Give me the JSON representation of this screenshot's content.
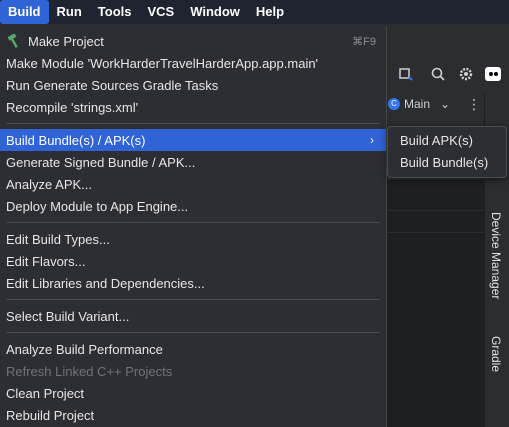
{
  "menubar": {
    "items": [
      "Build",
      "Run",
      "Tools",
      "VCS",
      "Window",
      "Help"
    ],
    "active": "Build"
  },
  "ide": {
    "branch_label": "Main",
    "right_tools": [
      "Device Manager",
      "Gradle"
    ]
  },
  "build_menu": {
    "make_project": {
      "label": "Make Project",
      "shortcut": "⌘F9"
    },
    "make_module": "Make Module 'WorkHarderTravelHarderApp.app.main'",
    "run_generate": "Run Generate Sources Gradle Tasks",
    "recompile": "Recompile 'strings.xml'",
    "build_bundle": "Build Bundle(s) / APK(s)",
    "generate_signed": "Generate Signed Bundle / APK...",
    "analyze_apk": "Analyze APK...",
    "deploy_module": "Deploy Module to App Engine...",
    "edit_build_types": "Edit Build Types...",
    "edit_flavors": "Edit Flavors...",
    "edit_libraries": "Edit Libraries and Dependencies...",
    "select_variant": "Select Build Variant...",
    "analyze_performance": "Analyze Build Performance",
    "refresh_cpp": "Refresh Linked C++ Projects",
    "clean_project": "Clean Project",
    "rebuild_project": "Rebuild Project"
  },
  "submenu": {
    "items": [
      "Build APK(s)",
      "Build Bundle(s)"
    ]
  },
  "colors": {
    "highlight": "#2f63d6",
    "menu_bg": "#2d2e33",
    "menubar_bg": "#1f2431",
    "disabled_text": "#6f737a"
  }
}
